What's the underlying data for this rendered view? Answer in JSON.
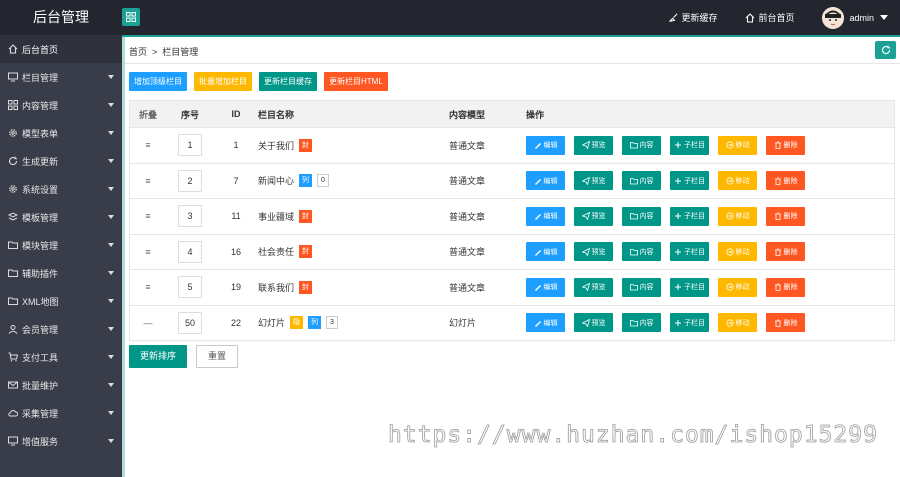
{
  "app": {
    "title": "后台管理"
  },
  "header": {
    "clear_cache_label": "更新缓存",
    "home_label": "前台首页",
    "user_name": "admin"
  },
  "sidebar": {
    "items": [
      {
        "label": "后台首页",
        "icon": "home-icon"
      },
      {
        "label": "栏目管理",
        "icon": "monitor-icon"
      },
      {
        "label": "内容管理",
        "icon": "grid-icon"
      },
      {
        "label": "模型表单",
        "icon": "gear-icon"
      },
      {
        "label": "生成更新",
        "icon": "refresh-icon"
      },
      {
        "label": "系统设置",
        "icon": "gear-icon"
      },
      {
        "label": "模板管理",
        "icon": "template-icon"
      },
      {
        "label": "模块管理",
        "icon": "folder-icon"
      },
      {
        "label": "辅助插件",
        "icon": "folder-icon"
      },
      {
        "label": "XML地图",
        "icon": "folder-icon"
      },
      {
        "label": "会员管理",
        "icon": "user-icon"
      },
      {
        "label": "支付工具",
        "icon": "cart-icon"
      },
      {
        "label": "批量维护",
        "icon": "mail-icon"
      },
      {
        "label": "采集管理",
        "icon": "cloud-icon"
      },
      {
        "label": "增值服务",
        "icon": "monitor-icon"
      }
    ]
  },
  "breadcrumb": {
    "home": "首页",
    "sep": ">",
    "current": "栏目管理"
  },
  "toolbar": {
    "add_top": "增加顶级栏目",
    "batch_add": "批量增加栏目",
    "update_cache": "更新栏目缓存",
    "update_html": "更新栏目HTML"
  },
  "table": {
    "headers": {
      "fold": "折叠",
      "seq": "序号",
      "id": "ID",
      "name": "栏目名称",
      "model": "内容模型",
      "ops": "操作"
    },
    "op_labels": {
      "edit": "编辑",
      "preview": "预览",
      "content": "内容",
      "sub": "子栏目",
      "move": "移动",
      "delete": "删除"
    },
    "rows": [
      {
        "fold": "≡",
        "seq": "1",
        "id": "1",
        "name": "关于我们",
        "tags": [
          {
            "text": "封",
            "kind": "red"
          }
        ],
        "model": "普通文章"
      },
      {
        "fold": "≡",
        "seq": "2",
        "id": "7",
        "name": "新闻中心",
        "tags": [
          {
            "text": "列",
            "kind": "blue"
          },
          {
            "text": "0",
            "kind": "outline"
          }
        ],
        "model": "普通文章"
      },
      {
        "fold": "≡",
        "seq": "3",
        "id": "11",
        "name": "事业疆域",
        "tags": [
          {
            "text": "封",
            "kind": "red"
          }
        ],
        "model": "普通文章"
      },
      {
        "fold": "≡",
        "seq": "4",
        "id": "16",
        "name": "社会责任",
        "tags": [
          {
            "text": "封",
            "kind": "red"
          }
        ],
        "model": "普通文章"
      },
      {
        "fold": "≡",
        "seq": "5",
        "id": "19",
        "name": "联系我们",
        "tags": [
          {
            "text": "封",
            "kind": "red"
          }
        ],
        "model": "普通文章"
      },
      {
        "fold": "—",
        "seq": "50",
        "id": "22",
        "name": "幻灯片",
        "tags": [
          {
            "text": "隐",
            "kind": "orange"
          },
          {
            "text": "列",
            "kind": "blue"
          },
          {
            "text": "3",
            "kind": "outline"
          }
        ],
        "model": "幻灯片"
      }
    ]
  },
  "footer_actions": {
    "update_sort": "更新排序",
    "reset": "重置"
  },
  "watermark": "https://www.huzhan.com/ishop15299",
  "colors": {
    "topbar": "#23262e",
    "sidebar": "#393d49",
    "accent": "#1aa094",
    "blue": "#1e9fff",
    "orange": "#ffb800",
    "green": "#009688",
    "red": "#ff5722"
  }
}
